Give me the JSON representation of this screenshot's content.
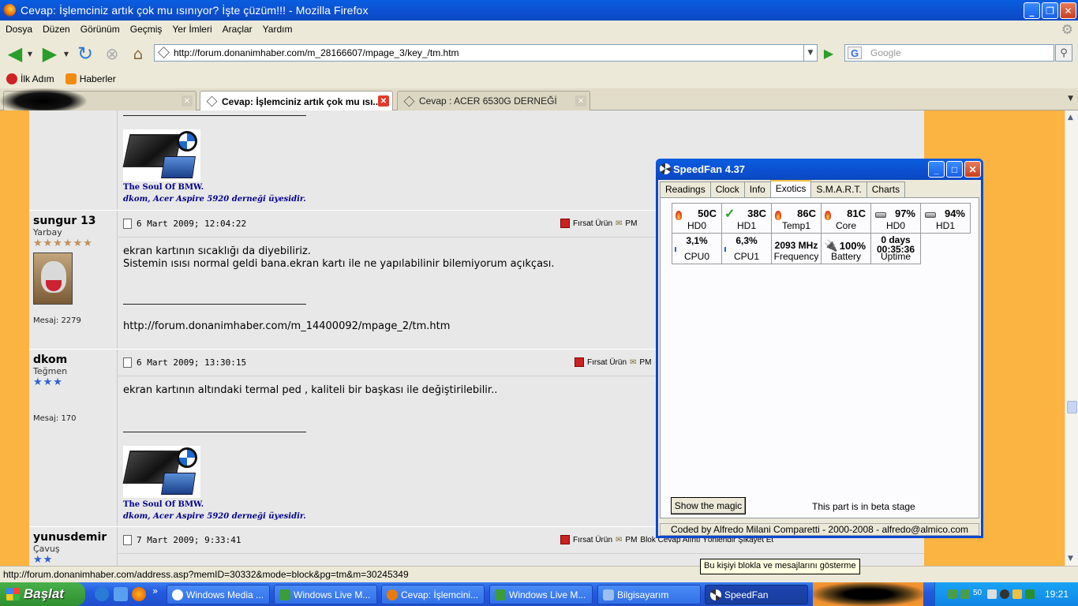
{
  "window": {
    "title": "Cevap: İşlemciniz artık çok mu ısınıyor? İşte çüzüm!!! - Mozilla Firefox"
  },
  "menu": [
    "Dosya",
    "Düzen",
    "Görünüm",
    "Geçmiş",
    "Yer İmleri",
    "Araçlar",
    "Yardım"
  ],
  "nav": {
    "url": "http://forum.donanimhaber.com/m_28166607/mpage_3/key_/tm.htm",
    "search_placeholder": "Google"
  },
  "bookmarks": [
    "İlk Adım",
    "Haberler"
  ],
  "tabs": [
    {
      "label": ""
    },
    {
      "label": "Cevap: İşlemciniz artık çok mu ısı..."
    },
    {
      "label": "Cevap : ACER 6530G DERNEĞİ"
    }
  ],
  "posts": {
    "sig": {
      "line1": "The Soul Of BMW.",
      "line2a": "dkom, Acer Aspire 5920 derneği",
      "line2b": "üyesidir."
    },
    "p1": {
      "user": "sungur 13",
      "rank": "Yarbay",
      "stars": "★★★★★★",
      "mesaj": "Mesaj: 2279",
      "date": "6 Mart 2009; 12:04:22",
      "text1": "ekran kartının sıcaklığı da diyebiliriz.",
      "text2": "Sistemin ısısı normal geldi bana.ekran kartı ile ne yapılabilinir bilemiyorum açıkçası.",
      "link": "http://forum.donanimhaber.com/m_14400092/mpage_2/tm.htm"
    },
    "p2": {
      "user": "dkom",
      "rank": "Teğmen",
      "stars": "★★★",
      "mesaj": "Mesaj: 170",
      "date": "6 Mart 2009; 13:30:15",
      "text1": "ekran kartının altındaki termal ped , kaliteli bir başkası ile değiştirilebilir.."
    },
    "p3": {
      "user": "yunusdemir",
      "rank": "Çavuş",
      "stars": "★★",
      "date": "7 Mart 2009; 9:33:41",
      "actions": "Blok  Cevap  Alıntı  Yönlendir  Şikayet Et"
    },
    "fursat": "Fırsat Ürün",
    "pm": "PM"
  },
  "status": {
    "text": "http://forum.donanimhaber.com/address.asp?memID=30332&mode=block&pg=tm&m=30245349",
    "tooltip": "Bu kişiyi blokla ve mesajlarını gösterme"
  },
  "speedfan": {
    "title": "SpeedFan 4.37",
    "tabs": [
      "Readings",
      "Clock",
      "Info",
      "Exotics",
      "S.M.A.R.T.",
      "Charts"
    ],
    "active_tab": "Exotics",
    "row1": [
      {
        "val": "50C",
        "lbl": "HD0",
        "icon": "flame-icon"
      },
      {
        "val": "38C",
        "lbl": "HD1",
        "icon": "check-icon"
      },
      {
        "val": "86C",
        "lbl": "Temp1",
        "icon": "flame-icon"
      },
      {
        "val": "81C",
        "lbl": "Core",
        "icon": "flame-icon"
      },
      {
        "val": "97%",
        "lbl": "HD0",
        "icon": "hdd-icon"
      },
      {
        "val": "94%",
        "lbl": "HD1",
        "icon": "hdd-icon"
      }
    ],
    "row2": [
      {
        "val": "3,1%",
        "lbl": "CPU0"
      },
      {
        "val": "6,3%",
        "lbl": "CPU1"
      },
      {
        "val": "2093 MHz",
        "lbl": "Frequency"
      },
      {
        "val": "100%",
        "lbl": "Battery"
      },
      {
        "val": "0 days",
        "val2": "00:35:36",
        "lbl": "Uptime"
      }
    ],
    "magic_button": "Show the magic",
    "beta": "This part is in beta stage",
    "credit": "Coded by Alfredo Milani Comparetti - 2000-2008 - alfredo@almico.com"
  },
  "taskbar": {
    "start": "Başlat",
    "buttons": [
      "Windows Media ...",
      "Windows Live M...",
      "Cevap: İşlemcini...",
      "Windows Live M...",
      "Bilgisayarım",
      "SpeedFan"
    ],
    "tray_num": "50",
    "clock": "19:21"
  }
}
